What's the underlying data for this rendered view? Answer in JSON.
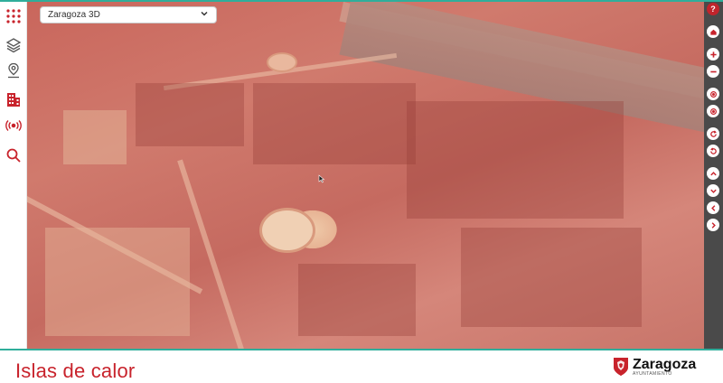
{
  "map_selector": {
    "value": "Zaragoza 3D"
  },
  "sidebar": {
    "items": [
      {
        "name": "apps-grid-icon"
      },
      {
        "name": "layers-icon"
      },
      {
        "name": "location-icon"
      },
      {
        "name": "building-icon"
      },
      {
        "name": "broadcast-icon"
      },
      {
        "name": "search-icon"
      }
    ]
  },
  "toolbar": {
    "help_label": "?"
  },
  "footer": {
    "title": "Islas de calor",
    "logo_name": "Zaragoza",
    "logo_sub": "AYUNTAMIENTO"
  },
  "colors": {
    "accent": "#2fae9b",
    "brand_red": "#c8232c",
    "toolbar_bg": "#4a4a4a"
  }
}
